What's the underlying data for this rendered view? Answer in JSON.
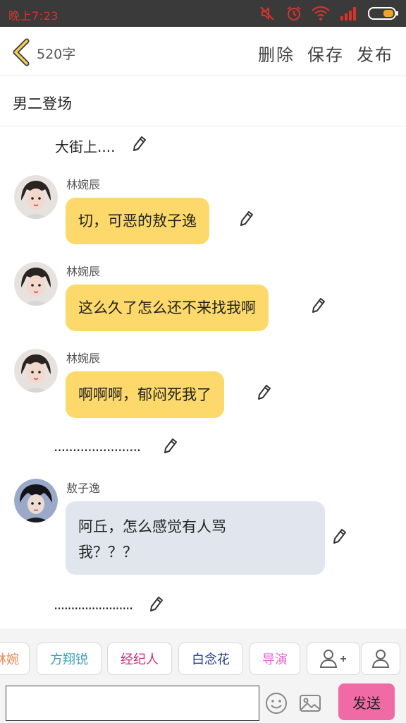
{
  "status_bar": {
    "time": "晚上7:23"
  },
  "header": {
    "word_count": "520字",
    "delete_label": "删除",
    "save_label": "保存",
    "publish_label": "发布"
  },
  "story": {
    "title": "男二登场"
  },
  "messages": [
    {
      "type": "narration",
      "text": "大街上...."
    },
    {
      "type": "chat",
      "speaker": "林婉辰",
      "text": "切，可恶的敖子逸"
    },
    {
      "type": "chat",
      "speaker": "林婉辰",
      "text": "这么久了怎么还不来找我啊"
    },
    {
      "type": "chat",
      "speaker": "林婉辰",
      "text": "啊啊啊，郁闷死我了"
    },
    {
      "type": "narration",
      "text": "......................."
    },
    {
      "type": "chat",
      "speaker": "敖子逸",
      "text_line1": "阿丘，怎么感觉有人骂",
      "text_line2": "我？？？"
    },
    {
      "type": "narration",
      "text": "......................."
    }
  ],
  "roles": [
    {
      "label": "林婉",
      "color": "#e58a52"
    },
    {
      "label": "方翔锐",
      "color": "#3aa0b8"
    },
    {
      "label": "经纪人",
      "color": "#cc2c7e"
    },
    {
      "label": "白念花",
      "color": "#1e3f8c"
    },
    {
      "label": "导演",
      "color": "#e36ad2"
    }
  ],
  "input": {
    "send_label": "发送"
  },
  "icons": [
    "back-chevron-icon",
    "pencil-icon",
    "add-person-icon",
    "person-icon",
    "emoji-icon",
    "image-icon",
    "mute-icon",
    "alarm-icon",
    "wifi-icon",
    "signal-icon",
    "battery-icon"
  ]
}
